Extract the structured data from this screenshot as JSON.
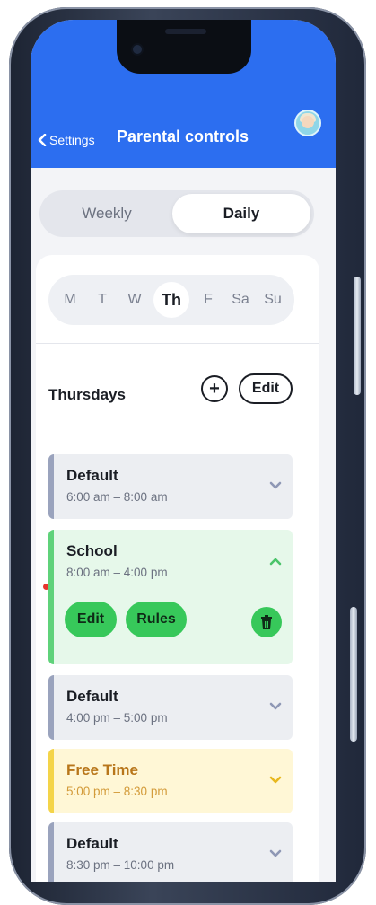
{
  "header": {
    "back_label": "Settings",
    "title": "Parental controls"
  },
  "view_toggle": {
    "options": [
      "Weekly",
      "Daily"
    ],
    "selected": "Daily"
  },
  "days": {
    "items": [
      "M",
      "T",
      "W",
      "Th",
      "F",
      "Sa",
      "Su"
    ],
    "selected": "Th"
  },
  "section": {
    "title": "Thursdays",
    "add_label": "+",
    "edit_label": "Edit"
  },
  "slots": [
    {
      "name": "Default",
      "time": "6:00 am – 8:00 am",
      "color": "grey"
    },
    {
      "name": "School",
      "time": "8:00 am – 4:00 pm",
      "color": "green",
      "edit_label": "Edit",
      "rules_label": "Rules"
    },
    {
      "name": "Default",
      "time": "4:00 pm – 5:00 pm",
      "color": "grey"
    },
    {
      "name": "Free Time",
      "time": "5:00 pm – 8:30 pm",
      "color": "yellow"
    },
    {
      "name": "Default",
      "time": "8:30 pm – 10:00 pm",
      "color": "grey"
    }
  ],
  "colors": {
    "header": "#2c6ef0",
    "green_accent": "#37c85a",
    "yellow_accent": "#f4d449",
    "grey_accent": "#9aa3bd"
  }
}
